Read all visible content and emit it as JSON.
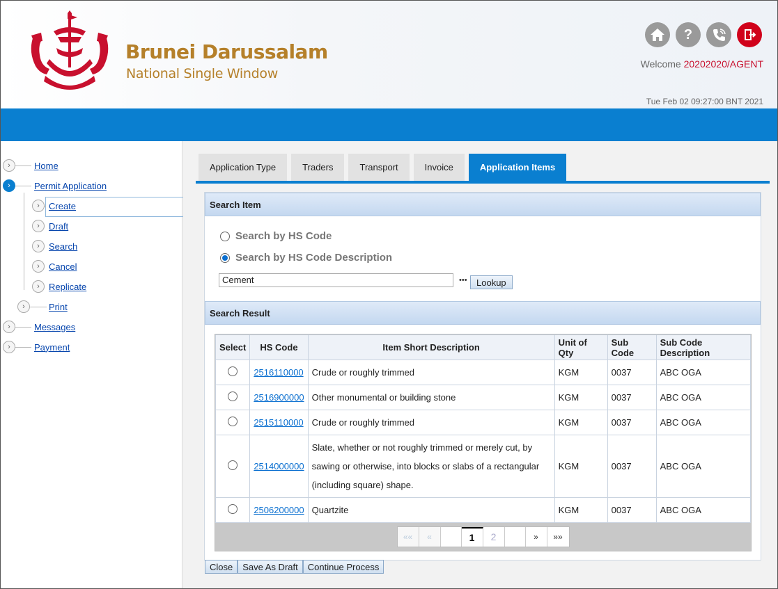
{
  "brand": {
    "title": "Brunei Darussalam",
    "subtitle": "National Single Window"
  },
  "header": {
    "icons": [
      "home-icon",
      "help-icon",
      "phone-icon",
      "logout-icon"
    ],
    "welcome_label": "Welcome",
    "user": "20202020/AGENT",
    "datetime": "Tue Feb 02 09:27:00 BNT 2021"
  },
  "sidebar": {
    "home": "Home",
    "permit_application": "Permit Application",
    "create": "Create",
    "draft": "Draft",
    "search": "Search",
    "cancel": "Cancel",
    "replicate": "Replicate",
    "print": "Print",
    "messages": "Messages",
    "payment": "Payment"
  },
  "tabs": [
    "Application Type",
    "Traders",
    "Transport",
    "Invoice",
    "Application Items"
  ],
  "search_item": {
    "heading": "Search Item",
    "option_hs_code": "Search by HS Code",
    "option_hs_desc": "Search by HS Code Description",
    "selected_option": "Search by HS Code Description",
    "query": "Cement",
    "lookup_label": "Lookup"
  },
  "search_result": {
    "heading": "Search Result",
    "columns": [
      "Select",
      "HS Code",
      "Item Short Description",
      "Unit of Qty",
      "Sub Code",
      "Sub Code Description"
    ],
    "rows": [
      {
        "hs_code": "2516110000",
        "description": "Crude or roughly trimmed",
        "unit": "KGM",
        "sub_code": "0037",
        "sub_desc": "ABC OGA"
      },
      {
        "hs_code": "2516900000",
        "description": "Other monumental or building stone",
        "unit": "KGM",
        "sub_code": "0037",
        "sub_desc": "ABC OGA"
      },
      {
        "hs_code": "2515110000",
        "description": "Crude or roughly trimmed",
        "unit": "KGM",
        "sub_code": "0037",
        "sub_desc": "ABC OGA"
      },
      {
        "hs_code": "2514000000",
        "description": "Slate, whether or not roughly trimmed or merely cut, by sawing or otherwise, into blocks or slabs of a rectangular (including square) shape.",
        "unit": "KGM",
        "sub_code": "0037",
        "sub_desc": "ABC OGA"
      },
      {
        "hs_code": "2506200000",
        "description": "Quartzite",
        "unit": "KGM",
        "sub_code": "0037",
        "sub_desc": "ABC OGA"
      }
    ],
    "pager": {
      "first": "««",
      "prev": "«",
      "page1": "1",
      "page2": "2",
      "next": "»",
      "last": "»»",
      "current_page": 1
    }
  },
  "actions": {
    "close": "Close",
    "save_draft": "Save As Draft",
    "continue": "Continue Process"
  },
  "colors": {
    "accent_blue": "#0a7fd0",
    "brand_gold": "#b5802a",
    "user_red": "#c8102e"
  }
}
